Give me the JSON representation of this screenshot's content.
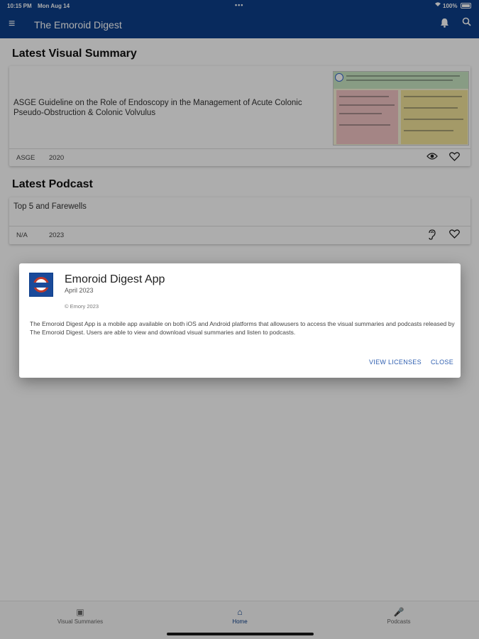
{
  "status_bar": {
    "time": "10:15 PM",
    "date": "Mon Aug 14",
    "dots": "•••",
    "battery": "100%"
  },
  "app_bar": {
    "title": "The Emoroid Digest",
    "menu_icon": "≡",
    "bell_icon": "🔔",
    "search_icon": "⌕"
  },
  "visual_summary": {
    "heading": "Latest Visual Summary",
    "title": "ASGE Guideline on the Role of Endoscopy in the Management of Acute Colonic Pseudo-Obstruction & Colonic Volvulus",
    "source": "ASGE",
    "year": "2020",
    "view_icon": "👁",
    "favorite_icon": "♡"
  },
  "podcast": {
    "heading": "Latest Podcast",
    "title": "Top 5 and Farewells",
    "source": "N/A",
    "year": "2023",
    "listen_icon": "👂",
    "favorite_icon": "♡"
  },
  "about_dialog": {
    "app_name": "Emoroid Digest App",
    "version": "April 2023",
    "legalese": "© Emory 2023",
    "description": "The Emoroid Digest App is a mobile app available on both iOS and Android platforms that allowusers to access the visual summaries and podcasts released by The Emoroid Digest. Users are able to view and download visual summaries and listen to podcasts.",
    "view_licenses_label": "VIEW LICENSES",
    "close_label": "CLOSE"
  },
  "bottom_nav": {
    "tabs": [
      {
        "label": "Visual Summaries",
        "icon": "▣"
      },
      {
        "label": "Home",
        "icon": "⌂"
      },
      {
        "label": "Podcasts",
        "icon": "🎤"
      }
    ],
    "active_tab": "Home"
  },
  "colors": {
    "primary": "#0d3f8a",
    "accent_link": "#2f5fb0"
  }
}
